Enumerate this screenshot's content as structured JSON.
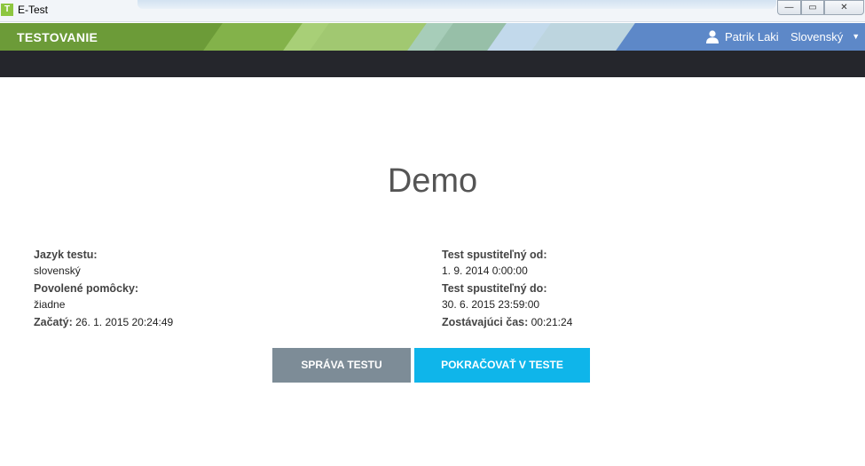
{
  "window": {
    "icon_letter": "T",
    "title": "E-Test",
    "min_glyph": "—",
    "max_glyph": "▭",
    "close_glyph": "✕"
  },
  "header": {
    "app_name": "TESTOVANIE",
    "user_name": "Patrik Laki",
    "language": "Slovenský",
    "caret": "▼"
  },
  "test": {
    "title": "Demo",
    "language_label": "Jazyk testu:",
    "language_value": "slovenský",
    "aids_label": "Povolené pomôcky:",
    "aids_value": "žiadne",
    "started_label": "Začatý:",
    "started_value": " 26. 1. 2015 20:24:49",
    "available_from_label": "Test spustiteľný od:",
    "available_from_value": "1. 9. 2014 0:00:00",
    "available_to_label": "Test spustiteľný do:",
    "available_to_value": "30. 6. 2015 23:59:00",
    "remaining_label": "Zostávajúci čas:",
    "remaining_value": " 00:21:24"
  },
  "actions": {
    "manage_label": "SPRÁVA TESTU",
    "continue_label": "POKRAČOVAŤ V TESTE"
  },
  "colors": {
    "header_green": "#6c9b38",
    "header_blue": "#5f8bc9",
    "dark_bar": "#25262c",
    "manage_button": "#7d8c97",
    "continue_button": "#0fb5ea"
  },
  "icons": {
    "user": "user-icon",
    "caret": "chevron-down-icon"
  }
}
